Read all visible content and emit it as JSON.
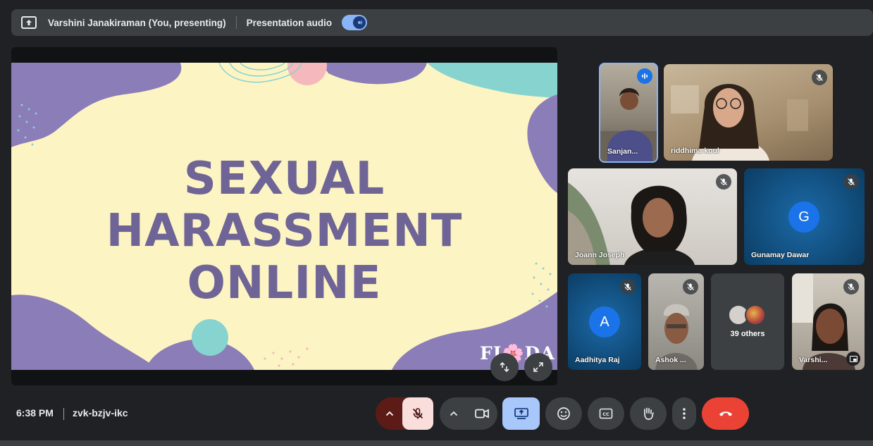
{
  "topbar": {
    "presenter": "Varshini Janakiraman (You, presenting)",
    "audio_label": "Presentation audio",
    "audio_on": true
  },
  "slide": {
    "title_lines": [
      "SEXUAL",
      "HARASSMENT",
      "ONLINE"
    ],
    "logo": "FI🌸DA"
  },
  "participants": [
    {
      "name": "Sanjan...",
      "speaking": true,
      "muted": false
    },
    {
      "name": "riddhima koul",
      "muted": true
    },
    {
      "name": "Joann Joseph",
      "muted": true
    },
    {
      "name": "Gunamay Dawar",
      "initial": "G",
      "muted": true
    },
    {
      "name": "Aadhitya Raj",
      "initial": "A",
      "muted": true
    },
    {
      "name": "Ashok ...",
      "muted": true
    },
    {
      "name": "39 others"
    },
    {
      "name": "Varshi...",
      "muted": true
    }
  ],
  "footer": {
    "time": "6:38 PM",
    "meeting_code": "zvk-bzjv-ikc"
  },
  "colors": {
    "background": "#202124",
    "accent": "#8ab4f8",
    "end_call": "#ea4335",
    "mic_off": "#f9dedc",
    "slide_purple": "#6f6496",
    "slide_cream": "#fdf4c3"
  },
  "icons": [
    "present-icon",
    "audio-icon",
    "collapse-icon",
    "fullscreen-icon",
    "speaking-icon",
    "mic-off-icon",
    "chevron-up-icon",
    "camera-icon",
    "present-now-icon",
    "emoji-icon",
    "captions-icon",
    "raise-hand-icon",
    "more-vert-icon",
    "end-call-icon"
  ]
}
